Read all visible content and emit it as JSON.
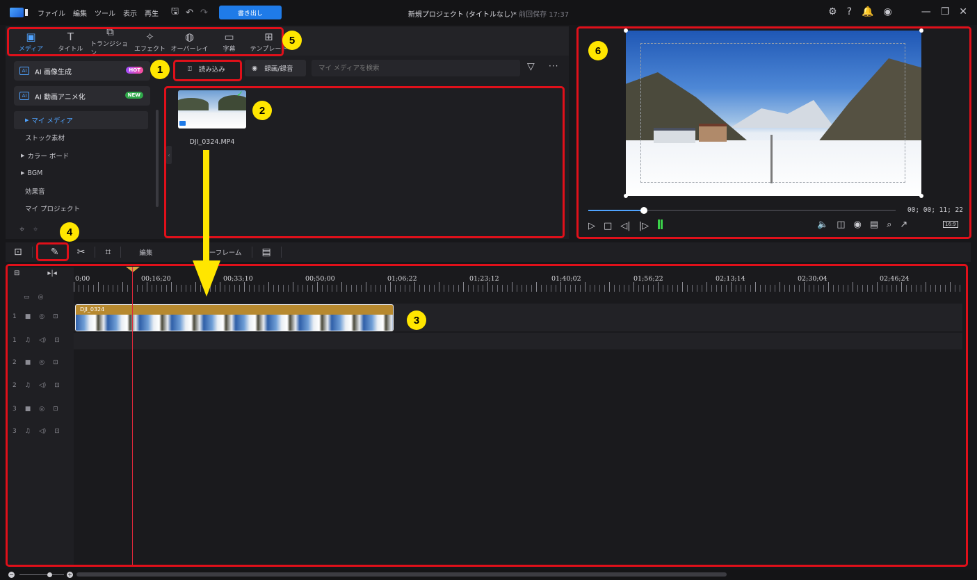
{
  "titlebar": {
    "menus": [
      "ファイル",
      "編集",
      "ツール",
      "表示",
      "再生"
    ],
    "export_label": "書き出し",
    "project_title": "新規プロジェクト (タイトルなし)*",
    "last_saved": "前回保存 17:37"
  },
  "library_tabs": [
    {
      "label": "メディア",
      "icon": "media-icon"
    },
    {
      "label": "タイトル",
      "icon": "title-icon"
    },
    {
      "label": "トランジション",
      "icon": "transition-icon"
    },
    {
      "label": "エフェクト",
      "icon": "effect-icon"
    },
    {
      "label": "オーバーレイ",
      "icon": "overlay-icon"
    },
    {
      "label": "字幕",
      "icon": "subtitle-icon"
    },
    {
      "label": "テンプレート",
      "icon": "template-icon"
    }
  ],
  "sidebar": {
    "ai_image": {
      "label": "AI 画像生成",
      "badge": "HOT"
    },
    "ai_anime": {
      "label": "AI 動画アニメ化",
      "badge": "NEW"
    },
    "items": [
      "マイ メディア",
      "ストック素材",
      "カラー ボード",
      "BGM",
      "効果音",
      "マイ プロジェクト"
    ]
  },
  "media": {
    "import_label": "読み込み",
    "record_label": "録画/録音",
    "search_placeholder": "マイ メディアを検索",
    "file_name": "DJI_0324.MP4"
  },
  "preview": {
    "timecode": "00; 00; 11; 22",
    "aspect": "16:9",
    "progress": 0.18
  },
  "toolbar": {
    "edit_label": "編集",
    "keyframe_label": "キーフレーム"
  },
  "timeline": {
    "ruler": [
      "0;00",
      "00;16;20",
      "00;33;10",
      "00;50;00",
      "01;06;22",
      "01;23;12",
      "01;40;02",
      "01;56;22",
      "02;13;14",
      "02;30;04",
      "02;46;24"
    ],
    "clip_name": "DJI_0324",
    "tracks": [
      "1",
      "1",
      "2",
      "2",
      "3",
      "3"
    ]
  },
  "annotations": [
    "1",
    "2",
    "3",
    "4",
    "5",
    "6"
  ],
  "colors": {
    "accent": "#1f7be8",
    "highlight": "#e0101a",
    "marker": "#ffe600"
  }
}
